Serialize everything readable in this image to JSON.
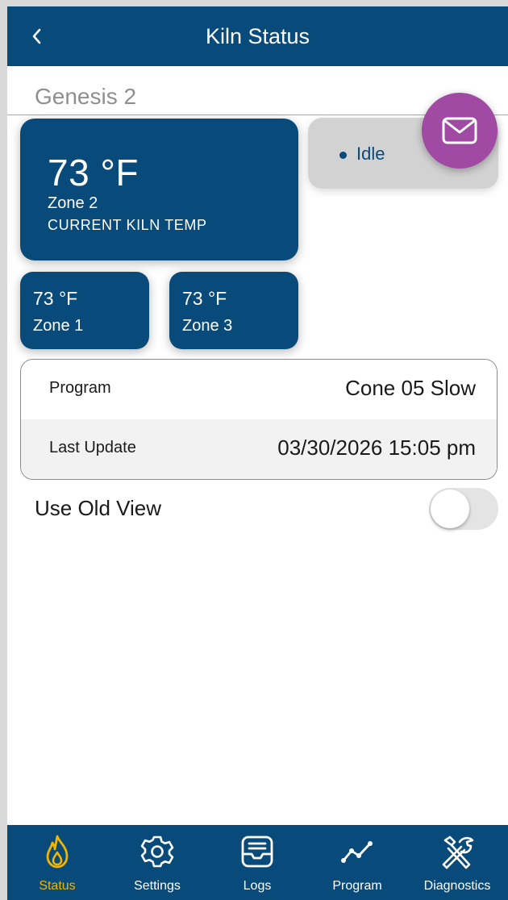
{
  "header": {
    "title": "Kiln Status",
    "back_icon": "chevron-left-icon"
  },
  "kiln": {
    "name": "Genesis 2"
  },
  "main_card": {
    "temp": "73 °F",
    "zone": "Zone 2",
    "subtitle": "CURRENT KILN TEMP"
  },
  "zones": [
    {
      "temp": "73 °F",
      "label": "Zone 1"
    },
    {
      "temp": "73 °F",
      "label": "Zone 3"
    }
  ],
  "status": {
    "text": "Idle"
  },
  "fab": {
    "icon": "envelope-icon"
  },
  "info": {
    "rows": [
      {
        "label": "Program",
        "value": "Cone 05 Slow"
      },
      {
        "label": "Last Update",
        "value": "03/30/2026 15:05 pm"
      }
    ]
  },
  "old_view": {
    "label": "Use Old View",
    "enabled": false
  },
  "nav": {
    "items": [
      {
        "label": "Status",
        "icon": "flame-icon",
        "active": true
      },
      {
        "label": "Settings",
        "icon": "gear-icon",
        "active": false
      },
      {
        "label": "Logs",
        "icon": "inbox-icon",
        "active": false
      },
      {
        "label": "Program",
        "icon": "line-chart-icon",
        "active": false
      },
      {
        "label": "Diagnostics",
        "icon": "tools-icon",
        "active": false
      }
    ]
  },
  "colors": {
    "primary": "#084a79",
    "accent": "#f2b400",
    "fab": "#a04aa4",
    "status_pill": "#d2d2d2"
  }
}
